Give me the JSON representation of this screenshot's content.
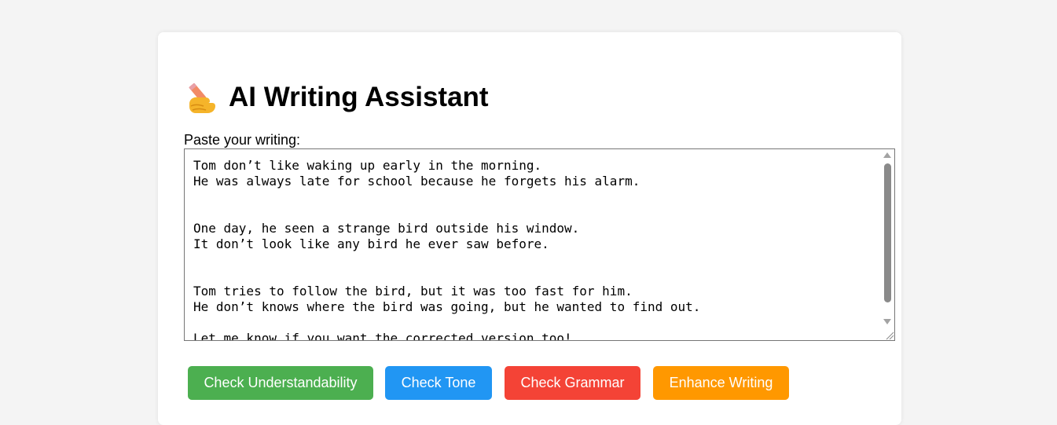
{
  "app": {
    "title": "AI Writing Assistant",
    "title_icon": "writing-hand-icon"
  },
  "editor": {
    "label": "Paste your writing:",
    "value": "Tom don’t like waking up early in the morning.\nHe was always late for school because he forgets his alarm.\n\n\nOne day, he seen a strange bird outside his window.\nIt don’t look like any bird he ever saw before.\n\n\nTom tries to follow the bird, but it was too fast for him.\nHe don’t knows where the bird was going, but he wanted to find out.\n\nLet me know if you want the corrected version too!"
  },
  "actions": [
    {
      "label": "Check Understandability",
      "color": "#4caf50"
    },
    {
      "label": "Check Tone",
      "color": "#2196f3"
    },
    {
      "label": "Check Grammar",
      "color": "#f44336"
    },
    {
      "label": "Enhance Writing",
      "color": "#ff9800"
    }
  ]
}
